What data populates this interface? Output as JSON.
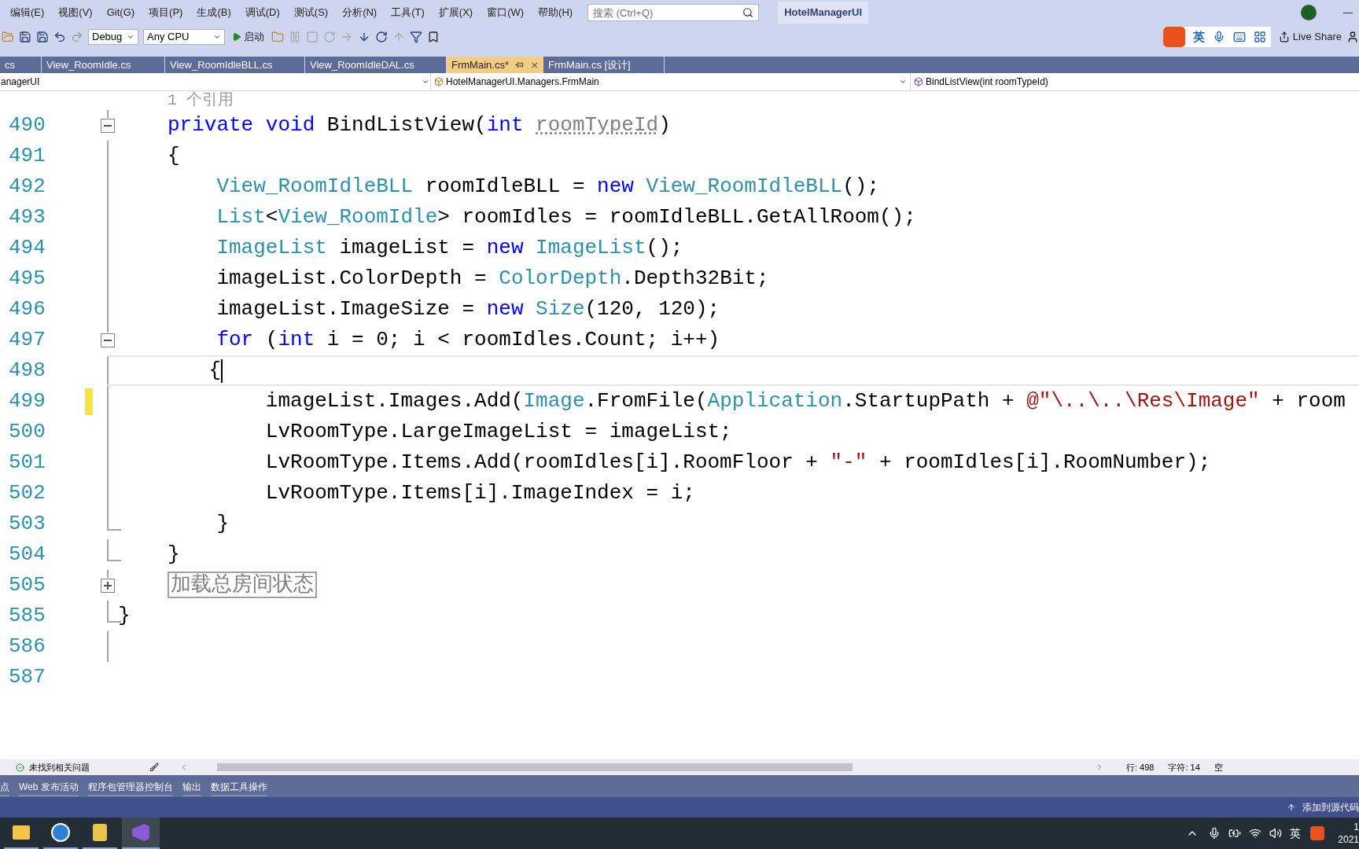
{
  "menu": [
    "编辑(E)",
    "视图(V)",
    "Git(G)",
    "项目(P)",
    "生成(B)",
    "调试(D)",
    "测试(S)",
    "分析(N)",
    "工具(T)",
    "扩展(X)",
    "窗口(W)",
    "帮助(H)"
  ],
  "search": {
    "placeholder": "搜索 (Ctrl+Q)"
  },
  "solution_title": "HotelManagerUI",
  "toolbar": {
    "configuration": "Debug",
    "platform": "Any CPU",
    "start": "启动",
    "ime_mode": "英",
    "live_share": "Live Share"
  },
  "tabs": [
    {
      "label": "cs",
      "selected": false,
      "modified_pinned": false
    },
    {
      "label": "View_RoomIdle.cs",
      "selected": false,
      "modified_pinned": false
    },
    {
      "label": "View_RoomIdleBLL.cs",
      "selected": false,
      "modified_pinned": false
    },
    {
      "label": "View_RoomIdleDAL.cs",
      "selected": false,
      "modified_pinned": false
    },
    {
      "label": "FrmMain.cs*",
      "selected": true,
      "modified_pinned": true
    },
    {
      "label": "FrmMain.cs [设计]",
      "selected": false,
      "modified_pinned": false
    }
  ],
  "navigation": {
    "project": "anagerUI",
    "class": "HotelManagerUI.Managers.FrmMain",
    "member": "BindListView(int roomTypeId)"
  },
  "codelens": "1 个引用",
  "lines": [
    {
      "number": "490",
      "kind": "fold-open",
      "changed": false,
      "current": false,
      "cursor": false,
      "tokens": [
        {
          "t": "private void ",
          "kind": "keyword"
        },
        {
          "t": "BindListView(",
          "kind": "plain"
        },
        {
          "t": "int ",
          "kind": "keyword"
        },
        {
          "t": "roomTypeId",
          "kind": "unused"
        },
        {
          "t": ")",
          "kind": "plain"
        }
      ]
    },
    {
      "number": "491",
      "kind": "inside",
      "changed": false,
      "current": false,
      "cursor": false,
      "tokens": [
        {
          "t": "{",
          "kind": "plain"
        }
      ]
    },
    {
      "number": "492",
      "kind": "inside",
      "changed": false,
      "current": false,
      "cursor": false,
      "tokens": [
        {
          "t": "    View_RoomIdleBLL",
          "kind": "type"
        },
        {
          "t": " roomIdleBLL = ",
          "kind": "plain"
        },
        {
          "t": "new ",
          "kind": "keyword"
        },
        {
          "t": "View_RoomIdleBLL",
          "kind": "type"
        },
        {
          "t": "();",
          "kind": "plain"
        }
      ]
    },
    {
      "number": "493",
      "kind": "inside",
      "changed": false,
      "current": false,
      "cursor": false,
      "tokens": [
        {
          "t": "    List",
          "kind": "type"
        },
        {
          "t": "<",
          "kind": "plain"
        },
        {
          "t": "View_RoomIdle",
          "kind": "type"
        },
        {
          "t": "> roomIdles = roomIdleBLL.GetAllRoom();",
          "kind": "plain"
        }
      ]
    },
    {
      "number": "494",
      "kind": "inside",
      "changed": false,
      "current": false,
      "cursor": false,
      "tokens": [
        {
          "t": "    ImageList",
          "kind": "type"
        },
        {
          "t": " imageList = ",
          "kind": "plain"
        },
        {
          "t": "new ",
          "kind": "keyword"
        },
        {
          "t": "ImageList",
          "kind": "type"
        },
        {
          "t": "();",
          "kind": "plain"
        }
      ]
    },
    {
      "number": "495",
      "kind": "inside",
      "changed": false,
      "current": false,
      "cursor": false,
      "tokens": [
        {
          "t": "    imageList.ColorDepth = ",
          "kind": "plain"
        },
        {
          "t": "ColorDepth",
          "kind": "type"
        },
        {
          "t": ".Depth32Bit;",
          "kind": "plain"
        }
      ]
    },
    {
      "number": "496",
      "kind": "inside",
      "changed": false,
      "current": false,
      "cursor": false,
      "tokens": [
        {
          "t": "    imageList.ImageSize = ",
          "kind": "plain"
        },
        {
          "t": "new ",
          "kind": "keyword"
        },
        {
          "t": "Size",
          "kind": "type"
        },
        {
          "t": "(120, 120);",
          "kind": "plain"
        }
      ]
    },
    {
      "number": "497",
      "kind": "fold-open",
      "changed": false,
      "current": false,
      "cursor": false,
      "tokens": [
        {
          "t": "    for ",
          "kind": "keyword"
        },
        {
          "t": "(",
          "kind": "plain"
        },
        {
          "t": "int ",
          "kind": "keyword"
        },
        {
          "t": "i = 0; i < roomIdles.Count; i++)",
          "kind": "plain"
        }
      ]
    },
    {
      "number": "498",
      "kind": "inside",
      "changed": false,
      "current": true,
      "cursor": true,
      "tokens": [
        {
          "t": "    {",
          "kind": "plain"
        }
      ]
    },
    {
      "number": "499",
      "kind": "inside",
      "changed": true,
      "current": false,
      "cursor": false,
      "tokens": [
        {
          "t": "        imageList.Images.Add(",
          "kind": "plain"
        },
        {
          "t": "Image",
          "kind": "type"
        },
        {
          "t": ".FromFile(",
          "kind": "plain"
        },
        {
          "t": "Application",
          "kind": "type"
        },
        {
          "t": ".StartupPath + ",
          "kind": "plain"
        },
        {
          "t": "@\"\\..\\..\\Res\\Image\"",
          "kind": "string"
        },
        {
          "t": " + room",
          "kind": "plain"
        }
      ]
    },
    {
      "number": "500",
      "kind": "inside",
      "changed": false,
      "current": false,
      "cursor": false,
      "tokens": [
        {
          "t": "        LvRoomType.LargeImageList = imageList;",
          "kind": "plain"
        }
      ]
    },
    {
      "number": "501",
      "kind": "inside",
      "changed": false,
      "current": false,
      "cursor": false,
      "tokens": [
        {
          "t": "        LvRoomType.Items.Add(roomIdles[i].RoomFloor + ",
          "kind": "plain"
        },
        {
          "t": "\"-\"",
          "kind": "string"
        },
        {
          "t": " + roomIdles[i].RoomNumber);",
          "kind": "plain"
        }
      ]
    },
    {
      "number": "502",
      "kind": "inside",
      "changed": false,
      "current": false,
      "cursor": false,
      "tokens": [
        {
          "t": "        LvRoomType.Items[i].ImageIndex = i;",
          "kind": "plain"
        }
      ]
    },
    {
      "number": "503",
      "kind": "fold-end",
      "changed": false,
      "current": false,
      "cursor": false,
      "tokens": [
        {
          "t": "    }",
          "kind": "plain"
        }
      ]
    },
    {
      "number": "504",
      "kind": "fold-end",
      "changed": false,
      "current": false,
      "cursor": false,
      "tokens": [
        {
          "t": "}",
          "kind": "plain"
        }
      ]
    },
    {
      "number": "505",
      "kind": "fold-closed",
      "changed": false,
      "current": false,
      "cursor": false,
      "tokens": [
        {
          "t": "加载总房间状态",
          "kind": "collapsed"
        }
      ]
    },
    {
      "number": "585",
      "kind": "fold-end",
      "changed": false,
      "current": false,
      "cursor": false,
      "tokens": [
        {
          "t": "}",
          "kind": "outdented"
        }
      ]
    },
    {
      "number": "586",
      "kind": "inside",
      "changed": false,
      "current": false,
      "cursor": false
    },
    {
      "number": "587",
      "kind": "plain",
      "changed": false,
      "current": false,
      "cursor": false
    }
  ],
  "editor_status": {
    "issues": "未找到相关问题",
    "line": "行: 498",
    "char": "字符: 14",
    "spaces": "空"
  },
  "tool_tabs": [
    "点",
    "Web 发布活动",
    "程序包管理器控制台",
    "输出",
    "数据工具操作"
  ],
  "status_bar": {
    "source_control": "添加到源代码"
  },
  "taskbar": {
    "ime": "英",
    "clock_time": "1",
    "clock_date": "2021"
  }
}
